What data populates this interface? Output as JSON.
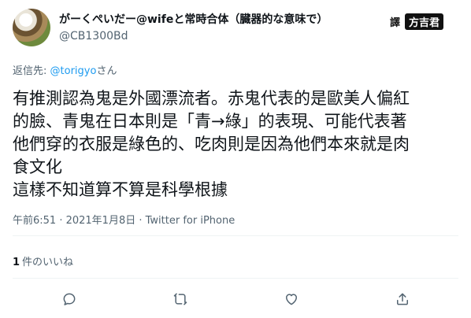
{
  "author": {
    "display_name": "がーくぺいだー@wifeと常時合体（臓器的な意味で）",
    "handle": "@CB1300Bd",
    "avatar_icon": "avatar-dog-photo-icon"
  },
  "watermark": {
    "prefix": "譯",
    "name": "方吉君"
  },
  "reply": {
    "label": "返信先:",
    "mention": "@torigyo",
    "suffix": "さん"
  },
  "tweet": {
    "text": "有推測認為鬼是外國漂流者。赤鬼代表的是歐美人偏紅\n的臉、青鬼在日本則是「青→綠」的表現、可能代表著\n他們穿的衣服是綠色的、吃肉則是因為他們本來就是肉\n食文化\n這樣不知道算不算是科學根據"
  },
  "meta": {
    "timestamp": "午前6:51 · 2021年1月8日",
    "source": "Twitter for iPhone"
  },
  "stats": {
    "likes_count": "1",
    "likes_label": "件のいいね"
  },
  "actions": {
    "icons": [
      "reply-icon",
      "retweet-icon",
      "like-icon",
      "share-icon"
    ]
  },
  "colors": {
    "text": "#0f1419",
    "secondary": "#536471",
    "link": "#1d9bf0",
    "divider": "#eff3f4"
  }
}
